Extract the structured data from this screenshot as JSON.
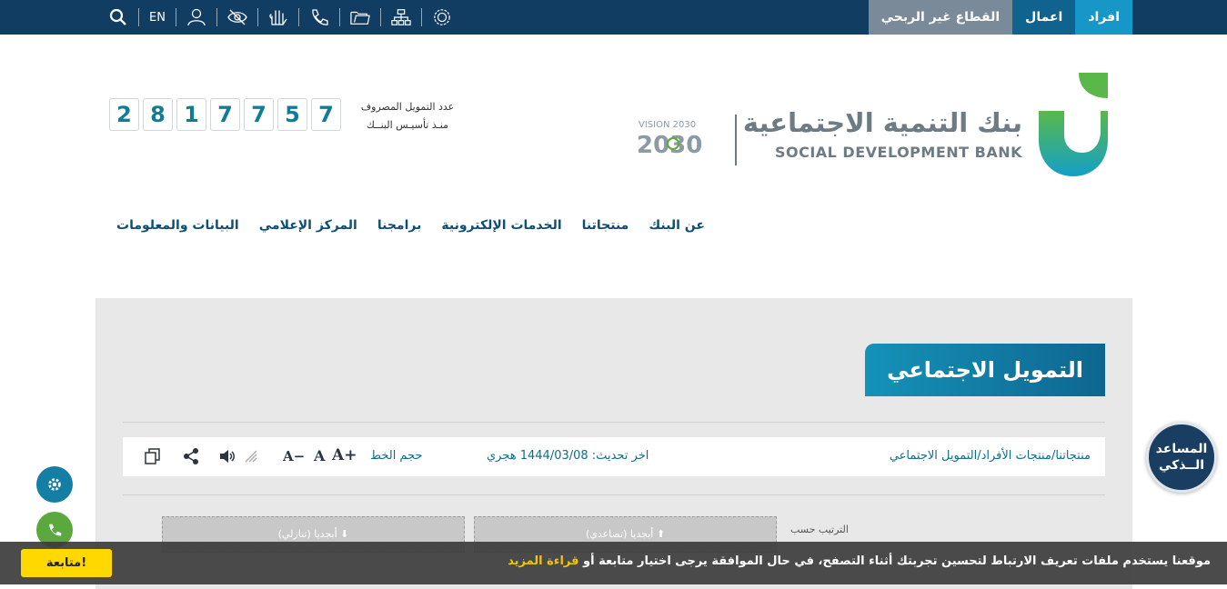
{
  "topbar": {
    "segments": [
      "افراد",
      "اعمال",
      "القطاع غير الربحي"
    ],
    "language": "EN",
    "icons": [
      "search-icon",
      "user-icon",
      "eye-slash-icon",
      "sign-language-icon",
      "phone-icon",
      "folder-icon",
      "sitemap-icon",
      "settings-badge-icon"
    ]
  },
  "logo": {
    "name_ar": "بنك التنمية الاجتماعية",
    "name_en": "SOCIAL DEVELOPMENT BANK",
    "vision": "VISION 2030"
  },
  "counter": {
    "label_line1": "عدد التمويل المصروف",
    "label_line2": "منـذ تأسيـس البنــك",
    "digits": [
      "2",
      "8",
      "1",
      "7",
      "7",
      "5",
      "7"
    ]
  },
  "nav": [
    "عن البنك",
    "منتجاتنا",
    "الخدمات الإلكترونية",
    "برامجنا",
    "المركز الإعلامي",
    "البيانات والمعلومات"
  ],
  "page": {
    "title": "التمويل الاجتماعي",
    "breadcrumb": "منتجاتنا/منتجات الأفراد/التمويل الاجتماعي",
    "updated": "اخر تحديث: 1444/03/08 هجري",
    "font_size_label": "حجم الخط",
    "font_plus": "A+",
    "font_normal": "A",
    "font_minus": "A−"
  },
  "sort": {
    "label": "الترتيب حسب",
    "ascending": "أبجديا (تصاعدي)",
    "descending": "أبجديا (تنازلي)"
  },
  "assistant": {
    "line1": "المساعد",
    "line2": "الــذكي"
  },
  "cookie": {
    "text": "موقعنا يستخدم ملفات تعريف الارتباط لتحسين تجربتك أثناء التصفح، في حال الموافقة يرجى اختيار متابعة أو",
    "more": "قراءة المزيد",
    "button": "متابعة!"
  },
  "colors": {
    "navy": "#123d63",
    "teal": "#1797c8",
    "green": "#5aa83e",
    "yellow": "#ffd800"
  }
}
